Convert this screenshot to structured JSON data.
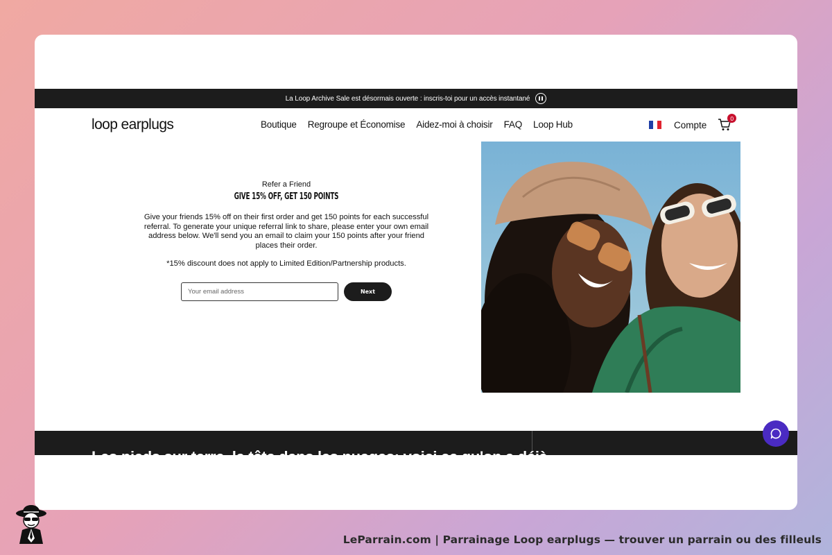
{
  "announcement": {
    "text": "La Loop Archive Sale est désormais ouverte : inscris-toi pour un accès instantané"
  },
  "header": {
    "logo": "loop earplugs",
    "nav": [
      "Boutique",
      "Regroupe et Économise",
      "Aidez-moi à choisir",
      "FAQ",
      "Loop Hub"
    ],
    "account": "Compte",
    "cart_count": "0"
  },
  "referral": {
    "kicker": "Refer a Friend",
    "headline": "GIVE 15% OFF, GET 150 POINTS",
    "body": "Give your friends 15% off on their first order and get 150 points for each successful referral. To generate your unique referral link to share, please enter your own email address below. We'll send you an email to claim your 150 points after your friend places their order.",
    "disclaimer": "*15% discount does not apply to Limited Edition/Partnership products.",
    "email_placeholder": "Your email address",
    "next_label": "Next"
  },
  "footer": {
    "text": "Les pieds sur terre, la tête dans les nuages: voici ce qu'on a déjà"
  },
  "caption": "LeParrain.com | Parrainage Loop earplugs — trouver un parrain ou des filleuls",
  "colors": {
    "accent_chat": "#4a2bc2",
    "cart_badge": "#c8102e",
    "bar_dark": "#1c1c1c"
  },
  "icons": [
    "pause-icon",
    "france-flag-icon",
    "cart-icon",
    "chat-icon",
    "mascot-icon"
  ]
}
